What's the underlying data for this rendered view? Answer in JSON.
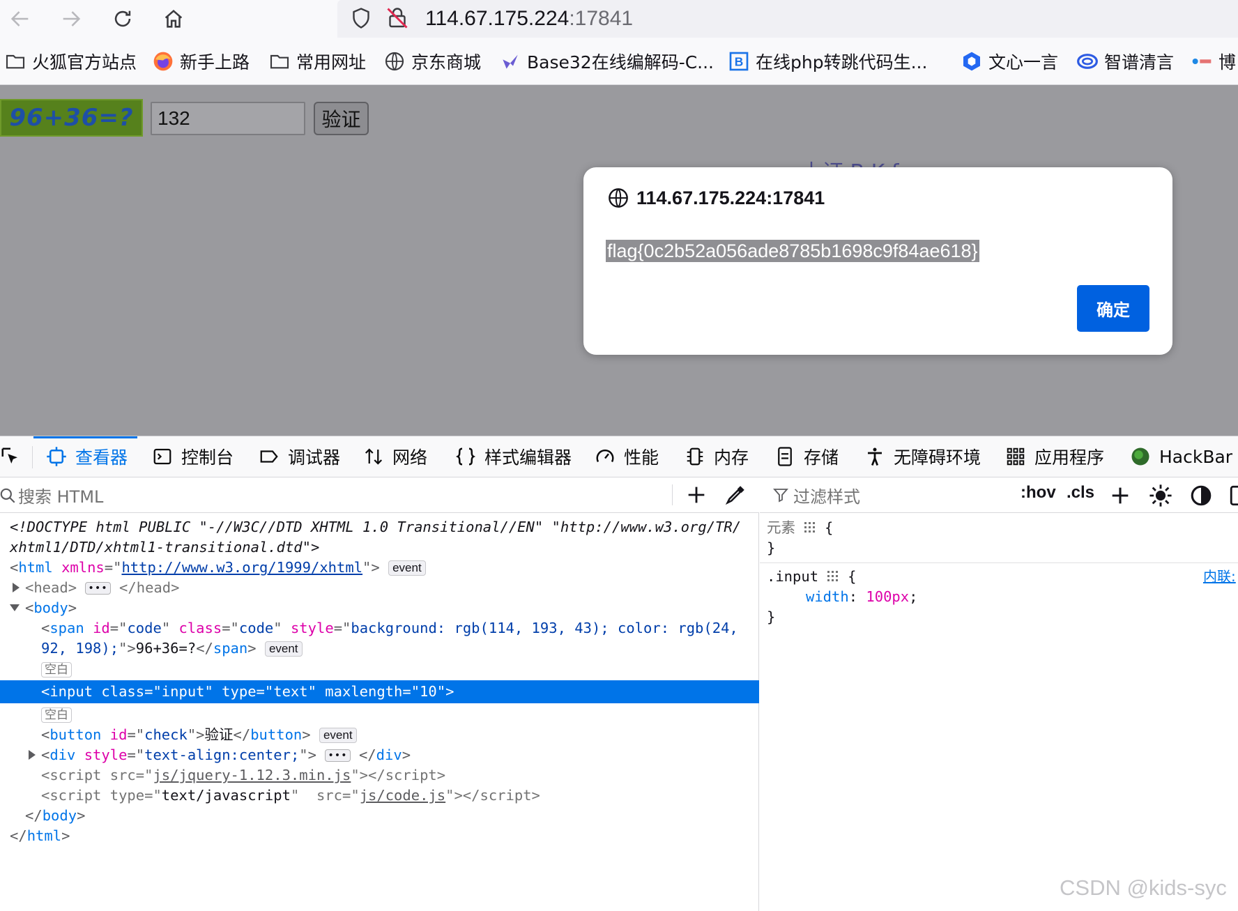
{
  "browser": {
    "url_host": "114.67.175.224",
    "url_port": ":17841"
  },
  "bookmarks": [
    {
      "label": "火狐官方站点",
      "icon": "folder-icon"
    },
    {
      "label": "新手上路",
      "icon": "firefox-icon"
    },
    {
      "label": "常用网址",
      "icon": "folder-icon"
    },
    {
      "label": "京东商城",
      "icon": "globe-icon"
    },
    {
      "label": "Base32在线编解码-C...",
      "icon": "site-icon"
    },
    {
      "label": "在线php转跳代码生...",
      "icon": "b-icon"
    },
    {
      "label": "文心一言",
      "icon": "wenxin-icon"
    },
    {
      "label": "智谱清言",
      "icon": "zhipu-icon"
    },
    {
      "label": "博",
      "icon": "cnblogs-icon"
    }
  ],
  "page": {
    "captcha_text": "96+36=?",
    "answer_value": "132",
    "verify_label": "验证",
    "bg_text": "上证 B  K  f"
  },
  "dialog": {
    "origin": "114.67.175.224:17841",
    "message": "flag{0c2b52a056ade8785b1698c9f84ae618}",
    "ok_label": "确定"
  },
  "devtools": {
    "tabs": [
      "查看器",
      "控制台",
      "调试器",
      "网络",
      "样式编辑器",
      "性能",
      "内存",
      "存储",
      "无障碍环境",
      "应用程序",
      "HackBar"
    ],
    "active_tab": "查看器",
    "search_placeholder": "搜索 HTML",
    "filter_placeholder": "过滤样式",
    "hov_label": ":hov",
    "cls_label": ".cls",
    "markup": {
      "doctype_1": "<!DOCTYPE html PUBLIC \"-//W3C//DTD XHTML 1.0 Transitional//EN\" \"http://www.w3.org/TR/",
      "doctype_2": "xhtml1/DTD/xhtml1-transitional.dtd\">",
      "html_xmlns": "http://www.w3.org/1999/xhtml",
      "span_style_1": "background: rgb(114, 193, 43); color: rgb(24,",
      "span_style_2": "92, 198);",
      "span_text": "96+36=?",
      "whitespace_label": "空白",
      "input_line": "<input class=\"input\" type=\"text\" maxlength=\"10\">",
      "button_text": "验证",
      "div_style": "text-align:center;",
      "script1_src": "js/jquery-1.12.3.min.js",
      "script2_type": "text/javascript",
      "script2_src": "js/code.js",
      "event_label": "event"
    },
    "rules": {
      "element_label": "元素",
      "inline_label": "内联:",
      "selector": ".input",
      "property": "width",
      "value": "100px"
    }
  },
  "watermark": "CSDN @kids-syc"
}
